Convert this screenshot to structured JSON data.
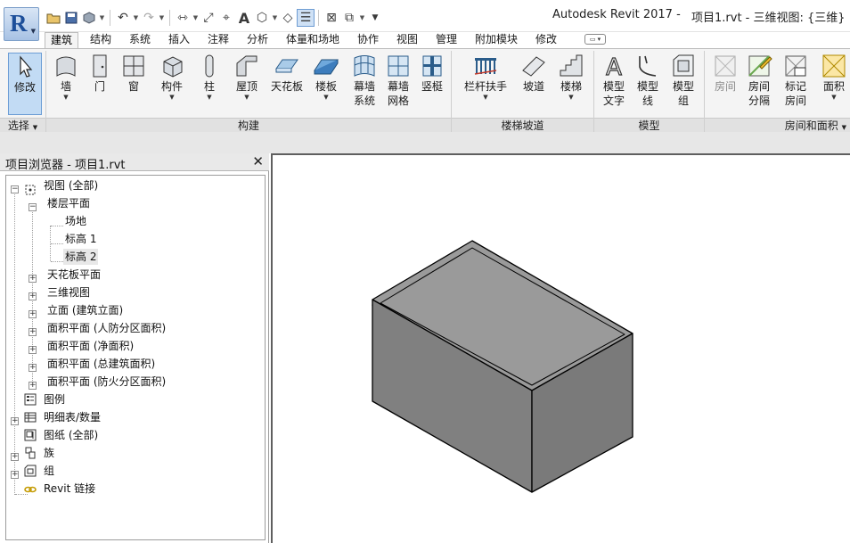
{
  "app": {
    "title": "Autodesk Revit 2017 -",
    "file_view": "项目1.rvt - 三维视图: {三维}",
    "logo": "R"
  },
  "tabs": [
    "建筑",
    "结构",
    "系统",
    "插入",
    "注释",
    "分析",
    "体量和场地",
    "协作",
    "视图",
    "管理",
    "附加模块",
    "修改"
  ],
  "active_tab": "建筑",
  "ribbon": {
    "modify": "修改",
    "wall": "墙",
    "door": "门",
    "window": "窗",
    "component": "构件",
    "column": "柱",
    "roof": "屋顶",
    "ceiling": "天花板",
    "floor": "楼板",
    "curtain_system_1": "幕墙",
    "curtain_system_2": "系统",
    "curtain_grid_1": "幕墙",
    "curtain_grid_2": "网格",
    "mullion": "竖梃",
    "railing": "栏杆扶手",
    "ramp": "坡道",
    "stair": "楼梯",
    "model_text_1": "模型",
    "model_text_2": "文字",
    "model_line_1": "模型",
    "model_line_2": "线",
    "model_group_1": "模型",
    "model_group_2": "组",
    "room": "房间",
    "room_sep_1": "房间",
    "room_sep_2": "分隔",
    "tag_room_1": "标记",
    "tag_room_2": "房间",
    "area": "面积",
    "panels": {
      "select": "选择",
      "build": "构建",
      "circulation": "楼梯坡道",
      "model": "模型",
      "room_area": "房间和面积"
    }
  },
  "browser": {
    "title": "项目浏览器 - 项目1.rvt",
    "nodes": {
      "views": "视图 (全部)",
      "floor_plans": "楼层平面",
      "site": "场地",
      "level1": "标高 1",
      "level2": "标高 2",
      "ceiling_plans": "天花板平面",
      "views_3d": "三维视图",
      "elevations": "立面 (建筑立面)",
      "area_civil": "面积平面 (人防分区面积)",
      "area_net": "面积平面 (净面积)",
      "area_gross": "面积平面 (总建筑面积)",
      "area_fire": "面积平面 (防火分区面积)",
      "legends": "图例",
      "schedules": "明细表/数量",
      "sheets": "图纸 (全部)",
      "families": "族",
      "groups": "组",
      "links": "Revit 链接"
    }
  },
  "colors": {
    "accent": "#6d9ed6",
    "selected_bg": "#c2dbf4",
    "model_face": "#808080",
    "model_edge": "#000000",
    "link_icon": "#c49a00"
  }
}
